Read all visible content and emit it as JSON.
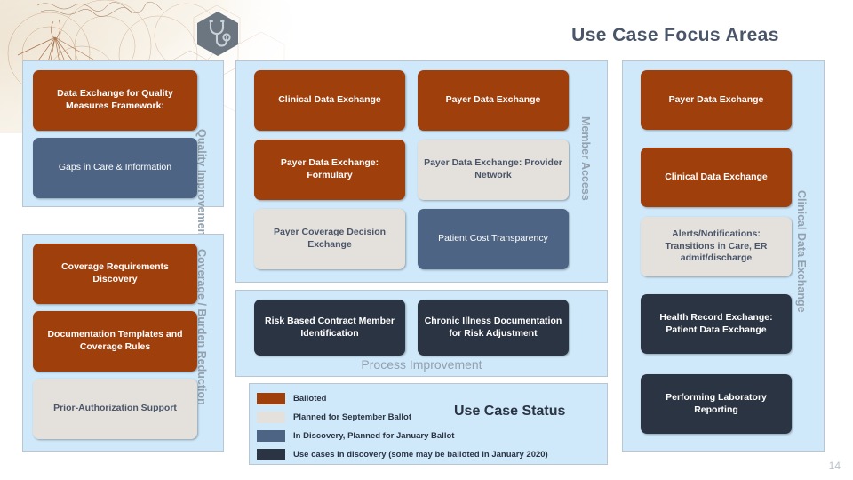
{
  "slide": {
    "title": "Use Case Focus Areas",
    "page_number": "14",
    "logo_icon": "stethoscope-hexagon-logo"
  },
  "colors": {
    "balloted": "#9f3f0c",
    "planned_september": "#e4e1dd",
    "in_discovery_january": "#4e6484",
    "use_cases_in_discovery": "#2b3442",
    "panel_background": "#cfe9fb",
    "panel_border": "#b9c6d2",
    "title_text": "#4a5568",
    "vertical_label_text": "#93a1ae"
  },
  "panels": [
    {
      "id": "quality-improvement",
      "vertical_label": "Quality Improvement",
      "boxes": [
        {
          "label": "Data Exchange for Quality Measures Framework:",
          "status": "balloted"
        },
        {
          "label": "Gaps in Care & Information",
          "status": "in_discovery_january"
        }
      ]
    },
    {
      "id": "coverage-burden-reduction",
      "vertical_label": "Coverage / Burden Reduction",
      "boxes": [
        {
          "label": "Coverage Requirements Discovery",
          "status": "balloted"
        },
        {
          "label": "Documentation Templates and Coverage Rules",
          "status": "balloted"
        },
        {
          "label": "Prior-Authorization Support",
          "status": "planned_september"
        }
      ]
    },
    {
      "id": "member-access",
      "vertical_label": "Member Access",
      "boxes": [
        {
          "label": "Clinical Data Exchange",
          "status": "balloted"
        },
        {
          "label": "Payer Data Exchange",
          "status": "balloted"
        },
        {
          "label": "Payer Data Exchange: Formulary",
          "status": "balloted"
        },
        {
          "label": "Payer Data Exchange: Provider Network",
          "status": "planned_september"
        },
        {
          "label": "Payer Coverage Decision Exchange",
          "status": "planned_september"
        },
        {
          "label": "Patient Cost Transparency",
          "status": "in_discovery_january"
        }
      ]
    },
    {
      "id": "process-improvement",
      "caption": "Process Improvement",
      "boxes": [
        {
          "label": "Risk Based Contract Member Identification",
          "status": "use_cases_in_discovery"
        },
        {
          "label": "Chronic Illness Documentation for Risk Adjustment",
          "status": "use_cases_in_discovery"
        }
      ]
    },
    {
      "id": "clinical-data-exchange",
      "vertical_label": "Clinical Data Exchange",
      "boxes": [
        {
          "label": "Payer Data Exchange",
          "status": "balloted"
        },
        {
          "label": "Clinical Data Exchange",
          "status": "balloted"
        },
        {
          "label": "Alerts/Notifications: Transitions in Care, ER admit/discharge",
          "status": "planned_september"
        },
        {
          "label": "Health Record Exchange: Patient Data Exchange",
          "status": "use_cases_in_discovery"
        },
        {
          "label": "Performing Laboratory Reporting",
          "status": "use_cases_in_discovery"
        }
      ]
    }
  ],
  "legend": {
    "title": "Use Case Status",
    "items": [
      {
        "label": "Balloted",
        "color": "#9f3f0c"
      },
      {
        "label": "Planned for September Ballot",
        "color": "#e4e1dd"
      },
      {
        "label": "In Discovery, Planned for January Ballot",
        "color": "#4e6484"
      },
      {
        "label": "Use cases in discovery (some may be balloted in January 2020)",
        "color": "#2b3442"
      }
    ]
  }
}
